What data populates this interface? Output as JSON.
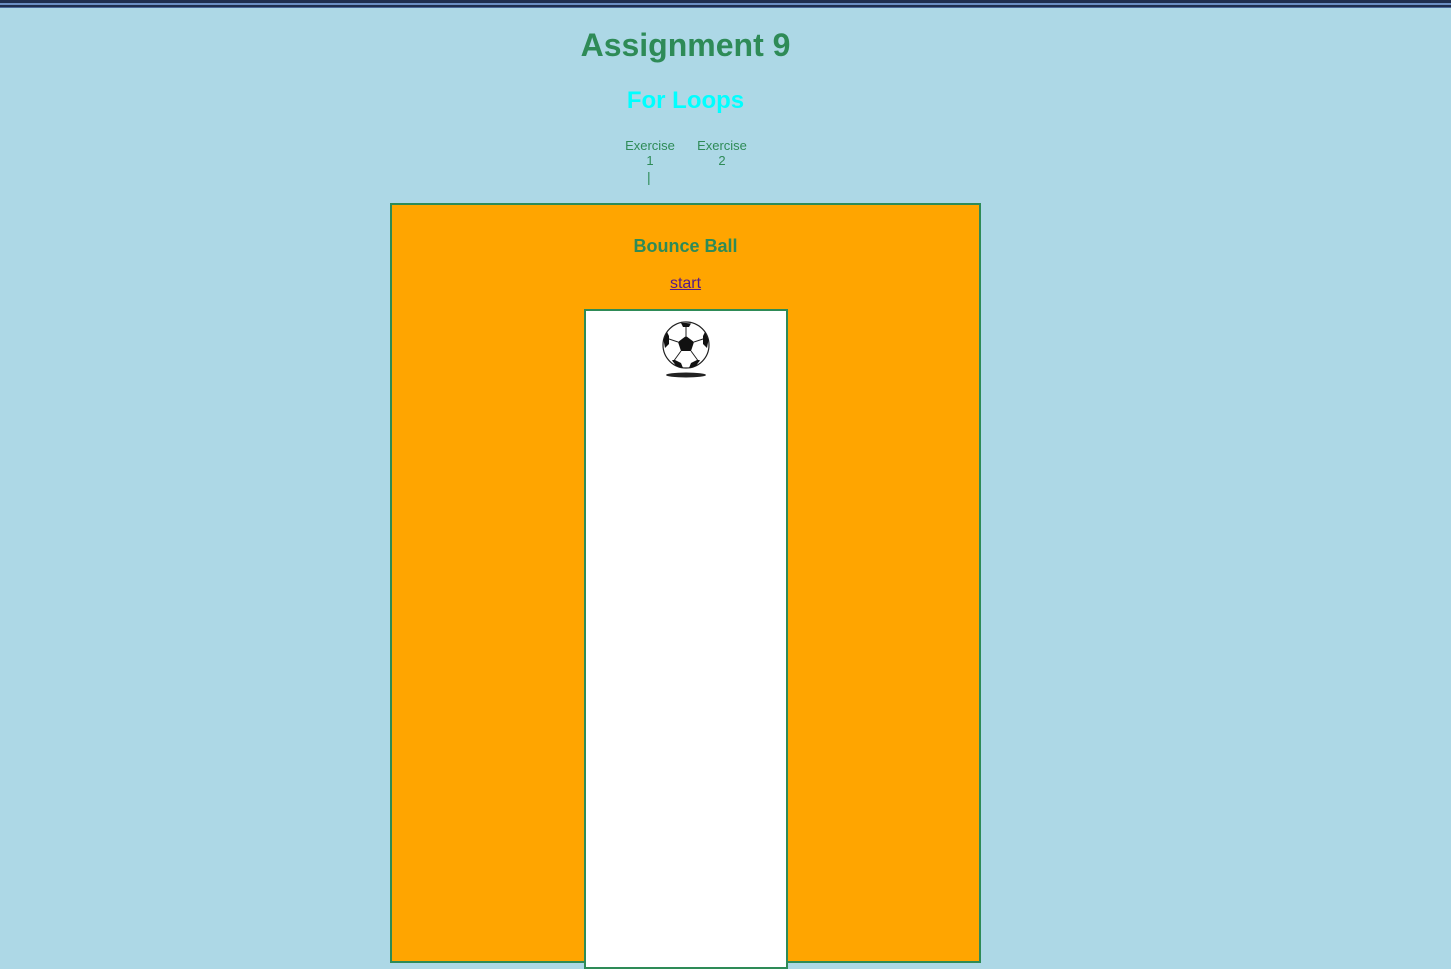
{
  "header": {
    "title": "Assignment 9",
    "subtitle": "For Loops"
  },
  "nav": {
    "items": [
      {
        "label": "Exercise",
        "number": "1"
      },
      {
        "label": "Exercise",
        "number": "2"
      }
    ],
    "separator": "|"
  },
  "panel": {
    "title": "Bounce Ball",
    "start_label": "start"
  },
  "canvas": {
    "ball_icon": "soccer-ball-icon"
  },
  "colors": {
    "page_background": "#add8e6",
    "heading": "#2e8b57",
    "subtitle": "#00ffff",
    "panel_background": "#ffa500",
    "canvas_background": "#ffffff",
    "link": "#551a8b"
  }
}
